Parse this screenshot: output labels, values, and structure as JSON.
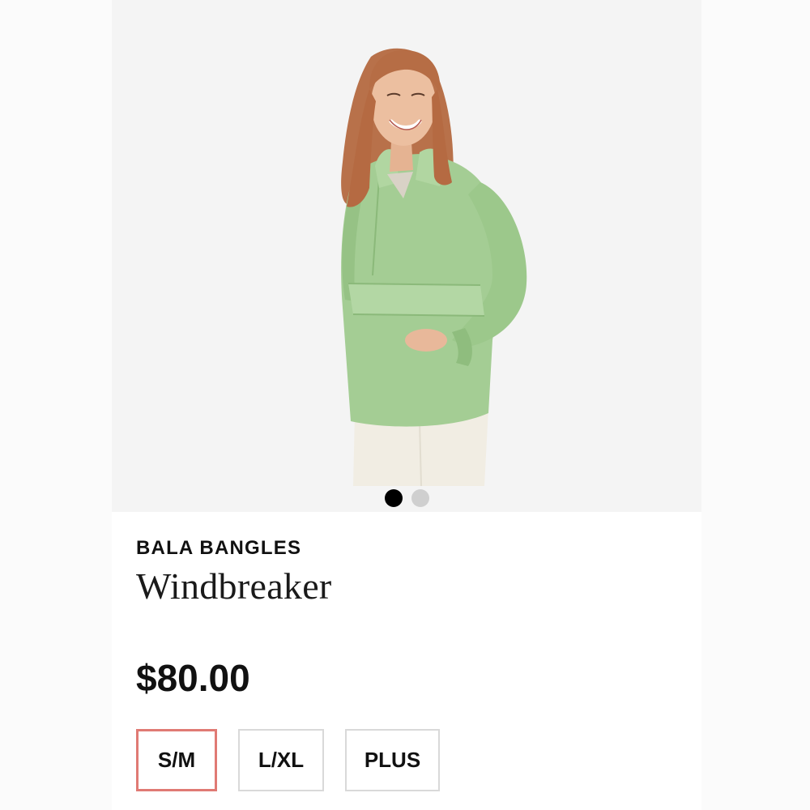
{
  "product": {
    "brand": "BALA BANGLES",
    "name": "Windbreaker",
    "price": "$80.00",
    "image_icon": "model-wearing-jacket-photo"
  },
  "gallery": {
    "image_count": 2,
    "active_index": 0
  },
  "sizes": {
    "options": [
      "S/M",
      "L/XL",
      "PLUS"
    ],
    "selected": "S/M"
  },
  "colors": {
    "jacket_green": "#9ec98e",
    "selected_border": "#e07a74",
    "dot_active": "#000000",
    "dot_inactive": "#cfcfcf"
  }
}
